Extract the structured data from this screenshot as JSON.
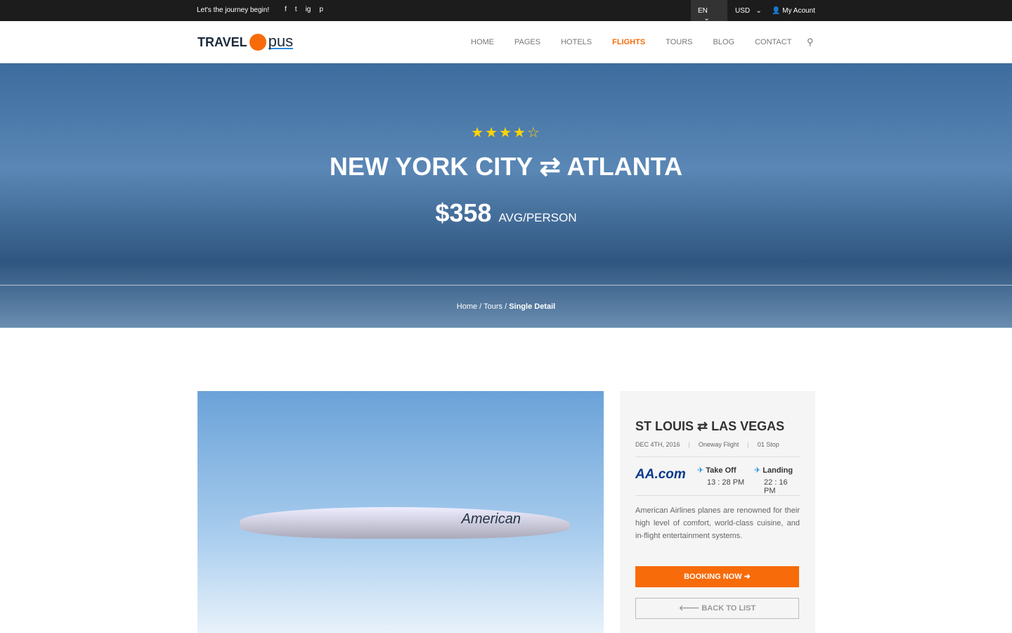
{
  "topbar": {
    "tagline": "Let's the journey begin!",
    "social": [
      "f",
      "t",
      "ig",
      "p"
    ],
    "lang": "EN",
    "currency": "USD",
    "account": "My Acount"
  },
  "logo": {
    "part1": "TRAVEL",
    "part2": "pus"
  },
  "nav": [
    "HOME",
    "PAGES",
    "HOTELS",
    "FLIGHTS",
    "TOURS",
    "BLOG",
    "CONTACT"
  ],
  "hero": {
    "stars": "★★★★☆",
    "rating": 4,
    "from": "NEW YORK CITY",
    "arrow": "⇄",
    "to": "ATLANTA",
    "price": "$358",
    "price_unit": "AVG/PERSON"
  },
  "breadcrumb": {
    "home": "Home",
    "tours": "Tours",
    "current": "Single Detail"
  },
  "photo": {
    "livery": "American"
  },
  "card": {
    "from": "ST LOUIS",
    "arrow": "⇄",
    "to": "LAS VEGAS",
    "date": "DEC 4TH, 2016",
    "type": "Oneway Flight",
    "stops": "01 Stop",
    "airline": "AA.com",
    "takeoff_label": "Take Off",
    "takeoff_time": "13 : 28 PM",
    "landing_label": "Landing",
    "landing_time": "22 : 16 PM",
    "description": "American Airlines planes are renowned for their high level of comfort, world-class cuisine, and in-flight entertainment systems.",
    "book": "BOOKING NOW ➜",
    "back": "🡐 BACK TO LIST"
  }
}
